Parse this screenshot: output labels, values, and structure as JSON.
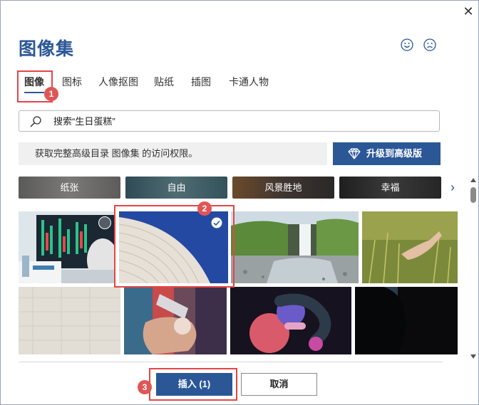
{
  "dialog": {
    "title": "图像集",
    "close_icon": "close-icon"
  },
  "feedback": {
    "happy_icon": "smiley-happy-icon",
    "sad_icon": "smiley-sad-icon"
  },
  "tabs": [
    {
      "label": "图像",
      "active": true
    },
    {
      "label": "图标",
      "active": false
    },
    {
      "label": "人像抠图",
      "active": false
    },
    {
      "label": "贴纸",
      "active": false
    },
    {
      "label": "插图",
      "active": false
    },
    {
      "label": "卡通人物",
      "active": false
    }
  ],
  "search": {
    "value": "搜索“生日蛋糕”",
    "icon": "search-icon"
  },
  "promo": {
    "text": "获取完整高级目录 图像集 的访问权限。",
    "upgrade_label": "升级到高级版",
    "upgrade_icon": "diamond-icon"
  },
  "categories": [
    {
      "label": "纸张"
    },
    {
      "label": "自由"
    },
    {
      "label": "风景胜地"
    },
    {
      "label": "幸福"
    }
  ],
  "images": [
    {
      "name": "stock-chart-image",
      "selected": false
    },
    {
      "name": "curved-paper-image",
      "selected": true
    },
    {
      "name": "waterfall-image",
      "selected": false
    },
    {
      "name": "wheat-field-image",
      "selected": false
    },
    {
      "name": "linen-texture-image",
      "selected": false
    },
    {
      "name": "paint-tubes-image",
      "selected": false
    },
    {
      "name": "abstract-3d-shapes-image",
      "selected": false
    },
    {
      "name": "silhouette-image",
      "selected": false
    }
  ],
  "annotations": [
    "1",
    "2",
    "3"
  ],
  "buttons": {
    "insert_label": "插入 (1)",
    "cancel_label": "取消"
  },
  "colors": {
    "accent": "#2b5797",
    "annotation_red": "#e64545"
  }
}
